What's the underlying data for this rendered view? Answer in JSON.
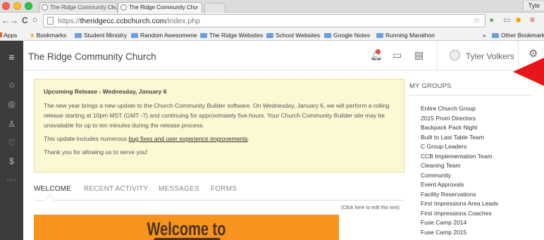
{
  "browser": {
    "tabs": [
      {
        "title": "The Ridge Community Chu",
        "active": false
      },
      {
        "title": "The Ridge Community Chu",
        "active": true
      }
    ],
    "profile_name": "Tyle",
    "url_prefix": "https://",
    "url_host": "theridgecc.ccbchurch.com",
    "url_path": "/index.php",
    "bookmarks": [
      {
        "label": "Apps",
        "icon": "apps-icon"
      },
      {
        "label": "Bookmarks",
        "icon": "bookmark-star-icon"
      },
      {
        "label": "Student Ministry",
        "icon": "folder-icon"
      },
      {
        "label": "Random Awesomene",
        "icon": "folder-icon"
      },
      {
        "label": "The Ridge Websites",
        "icon": "folder-icon"
      },
      {
        "label": "School Websites",
        "icon": "folder-icon"
      },
      {
        "label": "Google Notes",
        "icon": "folder-icon"
      },
      {
        "label": "Running Marathon",
        "icon": "folder-icon"
      }
    ],
    "overflow_label": "»",
    "other_bookmarks": "Other Bookmarks"
  },
  "app": {
    "title": "The Ridge Community Church",
    "user_name": "Tyler Volkers",
    "notice": {
      "title": "Upcoming Release - Wednesday, January 6",
      "paragraph1": "The new year brings a new update to the Church Community Builder software. On Wednesday, January 6, we will perform a rolling release starting at 10pm MST (GMT -7) and continuing for approximately five hours. Your Church Community Builder site may be unavailable for up to ten minutes during the release process.",
      "paragraph2_before": "This update includes numerous ",
      "paragraph2_link": "bug fixes and user experience improvements",
      "paragraph2_after": ".",
      "paragraph3": "Thank you for allowing us to serve you!"
    },
    "tabs": [
      "WELCOME",
      "RECENT ACTIVITY",
      "MESSAGES",
      "FORMS"
    ],
    "edit_link": "(Click here to edit this text)",
    "banner_title": "Welcome to",
    "groups_heading": "MY GROUPS",
    "groups": [
      "Entire Church Group",
      "2015 Prom Directors",
      "Backpack Pack Night",
      "Built to Last Table Team",
      "C Group Leaders",
      "CCB Implementation Team",
      "Cleaning Team",
      "Community",
      "Event Approvals",
      "Facility Reservations",
      "First Impressions Area Leads",
      "First Impressions Coaches",
      "Fuse Camp 2014",
      "Fuse Camp 2015"
    ]
  },
  "colors": {
    "sidebar": "#3c3c3c",
    "notice_bg": "#fbf8d4",
    "banner": "#f7941d",
    "annotation_arrow": "#e8151b",
    "notification_dot": "#e74c3c"
  }
}
